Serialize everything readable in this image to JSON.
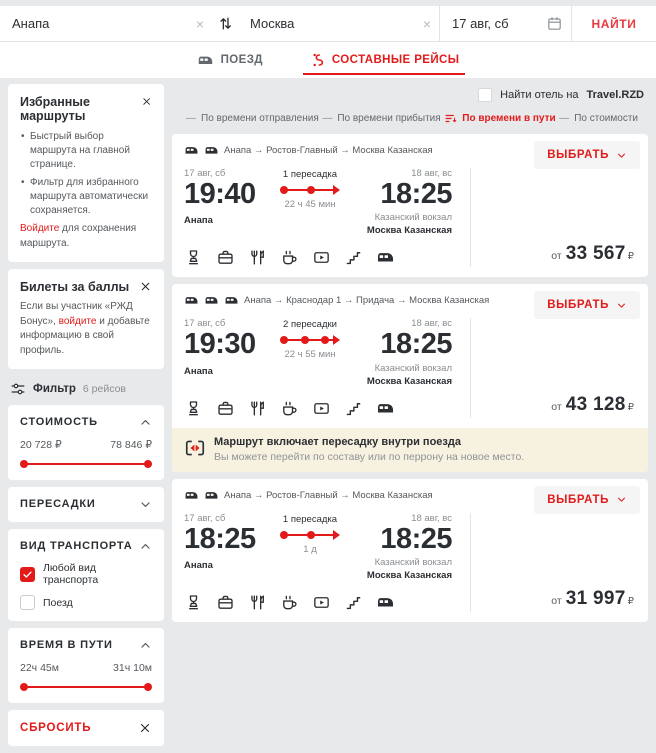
{
  "colors": {
    "accent": "#e21a1a",
    "page_bg": "#e8e9eb",
    "notice_bg": "#f7f1df"
  },
  "search": {
    "from": "Анапа",
    "to": "Москва",
    "date": "17 авг, сб",
    "find_label": "НАЙТИ",
    "swap_icon": "swap-arrows",
    "calendar_icon": "calendar",
    "clear_icon": "×"
  },
  "tabs": [
    {
      "label": "ПОЕЗД",
      "icon": "train-icon",
      "active": false
    },
    {
      "label": "СОСТАВНЫЕ РЕЙСЫ",
      "icon": "composite-route-icon",
      "active": true
    }
  ],
  "sidebar": {
    "favorites": {
      "title": "Избранные маршруты",
      "bullets": [
        "Быстрый выбор маршрута на главной странице.",
        "Фильтр для избранного маршрута автоматически сохраняется."
      ],
      "link_label": "Войдите",
      "link_suffix": " для сохранения маршрута."
    },
    "points": {
      "title": "Билеты за баллы",
      "text_before": "Если вы участник «РЖД Бонус», ",
      "link_label": "войдите",
      "text_after": " и добавьте информацию в свой профиль."
    },
    "filter": {
      "label": "Фильтр",
      "count": "6 рейсов",
      "icon": "filter-sliders-icon"
    },
    "price": {
      "title": "СТОИМОСТЬ",
      "min": "20 728 ₽",
      "max": "78 846 ₽"
    },
    "transfers": {
      "title": "ПЕРЕСАДКИ"
    },
    "transport": {
      "title": "ВИД ТРАНСПОРТА",
      "options": [
        {
          "label": "Любой вид транспорта",
          "checked": true
        },
        {
          "label": "Поезд",
          "checked": false
        }
      ]
    },
    "duration": {
      "title": "ВРЕМЯ В ПУТИ",
      "min": "22ч 45м",
      "max": "31ч 10м"
    },
    "reset_label": "СБРОСИТЬ"
  },
  "main": {
    "hotel": {
      "text": "Найти отель на",
      "link": "Travel.RZD"
    },
    "sorts": [
      {
        "label": "По времени отправления",
        "active": false
      },
      {
        "label": "По времени прибытия",
        "active": false
      },
      {
        "label": "По времени в пути",
        "active": true
      },
      {
        "label": "По стоимости",
        "active": false
      }
    ],
    "select_label": "ВЫБРАТЬ",
    "price_prefix": "от",
    "currency": "₽",
    "amenity_icons": [
      "firm-train-trophy",
      "baggage",
      "dining-car",
      "tea",
      "video",
      "stairs",
      "train"
    ],
    "cards": [
      {
        "train_count": 2,
        "route": "Анапа → Ростов-Главный → Москва Казанская",
        "dep": {
          "date": "17 авг, сб",
          "time": "19:40",
          "station": "Анапа"
        },
        "mid": {
          "top": "1 пересадка",
          "bottom": "22 ч 45 мин",
          "stops": 1
        },
        "arr": {
          "date": "18 авг, вс",
          "time": "18:25",
          "station_sub": "Казанский вокзал",
          "station": "Москва Казанская"
        },
        "price": "33 567"
      },
      {
        "train_count": 3,
        "route": "Анапа → Краснодар 1 → Придача → Москва Казанская",
        "dep": {
          "date": "17 авг, сб",
          "time": "19:30",
          "station": "Анапа"
        },
        "mid": {
          "top": "2 пересадки",
          "bottom": "22 ч 55 мин",
          "stops": 2
        },
        "arr": {
          "date": "18 авг, вс",
          "time": "18:25",
          "station_sub": "Казанский вокзал",
          "station": "Москва Казанская"
        },
        "price": "43 128",
        "notice": {
          "title": "Маршрут включает пересадку внутри поезда",
          "text": "Вы можете перейти по составу или по перрону на новое место."
        }
      },
      {
        "train_count": 2,
        "route": "Анапа → Ростов-Главный → Москва Казанская",
        "dep": {
          "date": "17 авг, сб",
          "time": "18:25",
          "station": "Анапа"
        },
        "mid": {
          "top": "1 пересадка",
          "bottom": "1 д",
          "stops": 1
        },
        "arr": {
          "date": "18 авг, вс",
          "time": "18:25",
          "station_sub": "Казанский вокзал",
          "station": "Москва Казанская"
        },
        "price": "31 997"
      }
    ]
  }
}
